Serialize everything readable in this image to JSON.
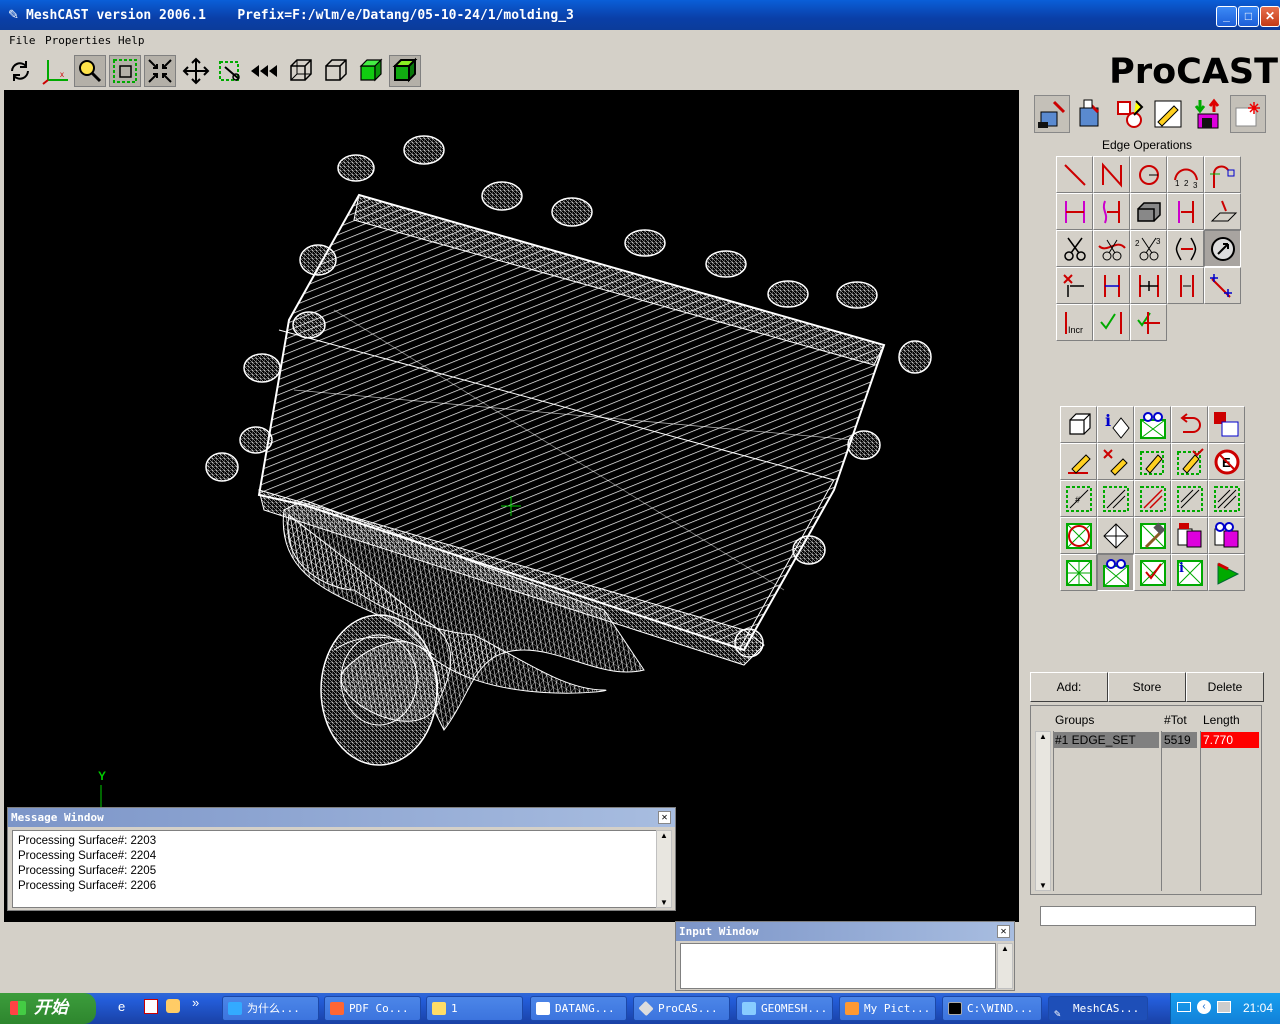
{
  "window": {
    "title": "MeshCAST version 2006.1    Prefix=F:/wlm/e/Datang/05-10-24/1/molding_3",
    "minimize": "_",
    "maximize": "□",
    "close": "✕"
  },
  "menu": {
    "file": "File",
    "properties": "Properties",
    "help": "Help"
  },
  "logo": "ProCAST",
  "axis": {
    "y": "Y"
  },
  "edge_ops": {
    "title": "Edge Operations"
  },
  "actions": {
    "add": "Add:",
    "store": "Store",
    "delete": "Delete"
  },
  "groups": {
    "col_groups": "Groups",
    "col_tot": "#Tot",
    "col_length": "Length",
    "row": {
      "name": "#1  EDGE_SET",
      "tot": "5519",
      "length": "7.770"
    },
    "row_colors": {
      "selected": "#808080",
      "length_bg": "#ff0000"
    }
  },
  "message_window": {
    "title": "Message Window",
    "lines": [
      "Processing Surface#: 2203",
      "Processing Surface#: 2204",
      "Processing Surface#: 2205",
      "Processing Surface#: 2206"
    ]
  },
  "input_window": {
    "title": "Input Window"
  },
  "taskbar": {
    "start": "开始",
    "tasks": [
      {
        "label": "为什么...",
        "icon": "ie-icon"
      },
      {
        "label": "PDF Co...",
        "icon": "pdf-icon"
      },
      {
        "label": "1",
        "icon": "folder-icon"
      },
      {
        "label": "DATANG...",
        "icon": "doc-icon"
      },
      {
        "label": "ProCAS...",
        "icon": "procast-icon"
      },
      {
        "label": "GEOMESH...",
        "icon": "image-icon"
      },
      {
        "label": "My Pict...",
        "icon": "camera-icon"
      },
      {
        "label": "C:\\WIND...",
        "icon": "cmd-icon"
      },
      {
        "label": "MeshCAS...",
        "icon": "meshcast-icon"
      }
    ],
    "clock": "21:04"
  },
  "colors": {
    "viewport_bg": "#000000",
    "mesh": "#ffffff",
    "titlebar": "#0a4fc8"
  }
}
